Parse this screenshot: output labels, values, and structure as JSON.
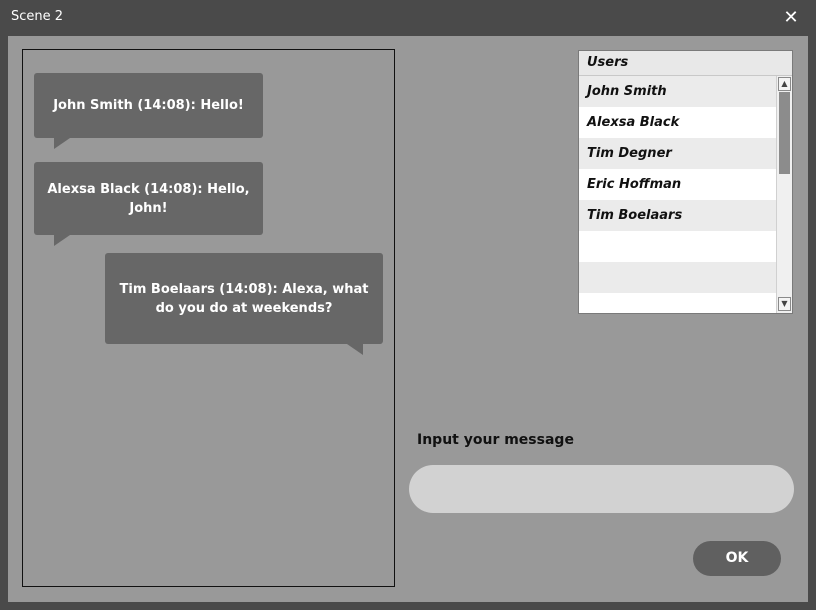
{
  "window": {
    "title": "Scene 2",
    "close_symbol": "✕"
  },
  "messages": [
    {
      "text": "John Smith (14:08): Hello!"
    },
    {
      "text": "Alexsa Black (14:08): Hello, John!"
    },
    {
      "text": "Tim Boelaars (14:08): Alexa, what do you do at weekends?"
    }
  ],
  "users": {
    "header": "Users",
    "items": [
      "John Smith",
      "Alexsa Black",
      "Tim Degner",
      "Eric Hoffman",
      "Tim Boelaars"
    ],
    "scroll_up_symbol": "▲",
    "scroll_down_symbol": "▼"
  },
  "message_input": {
    "label": "Input your message",
    "value": "",
    "placeholder": ""
  },
  "ok_button": {
    "label": "OK"
  },
  "colors": {
    "window_frame": "#4a4a4a",
    "content_bg": "#999999",
    "bubble": "#676767",
    "input_bg": "#d2d2d2",
    "ok_button": "#606060"
  }
}
